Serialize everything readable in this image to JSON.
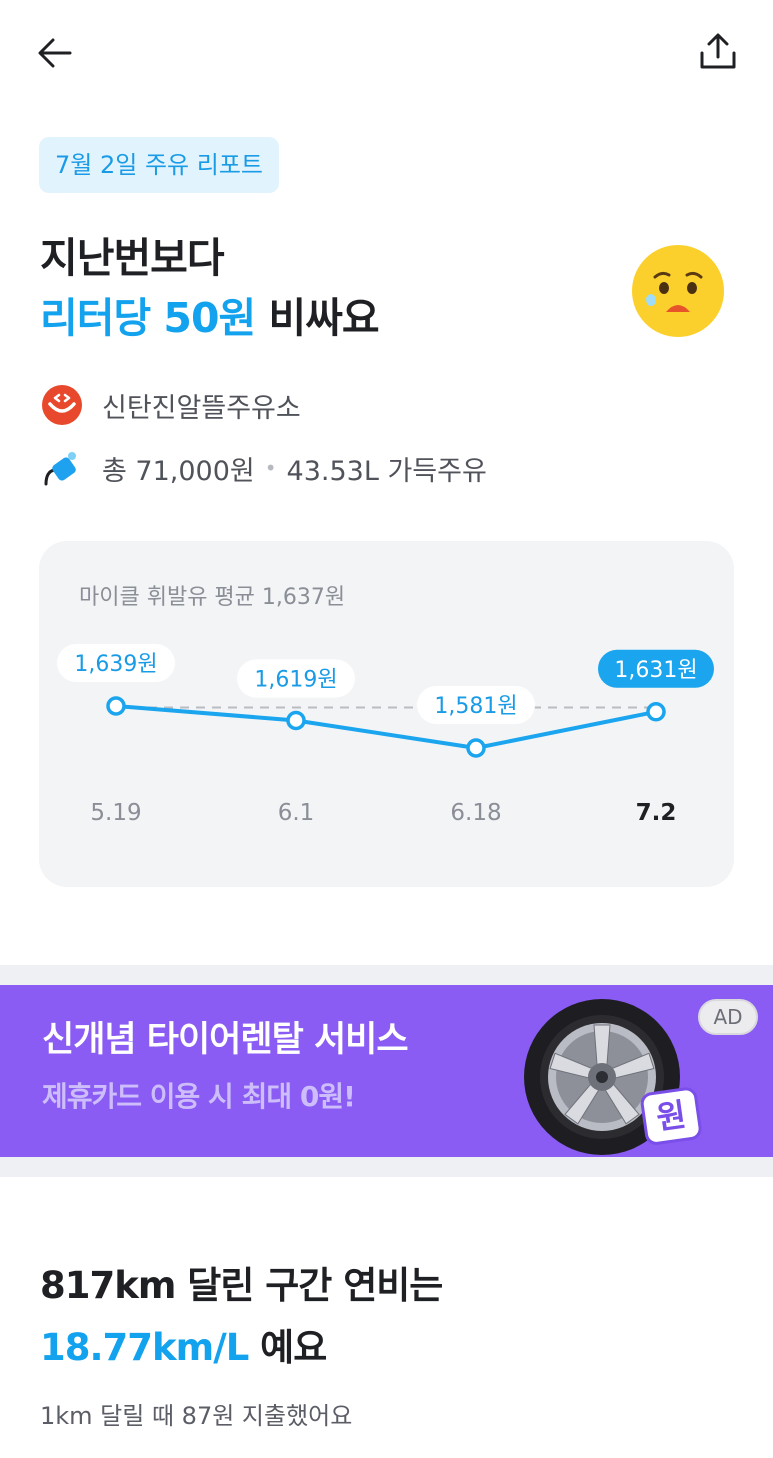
{
  "report_chip": "7월 2일 주유 리포트",
  "headline": {
    "line1": "지난번보다",
    "accent": "리터당 50원",
    "suffix": " 비싸요"
  },
  "station": {
    "name": "신탄진알뜰주유소",
    "icon": "smiley-logo-icon"
  },
  "fuel": {
    "total": "총 71,000원",
    "separator": "•",
    "detail": "43.53L 가득주유",
    "icon": "fuel-nozzle-icon"
  },
  "chart": {
    "avg_label": "마이클 휘발유 평균 1,637원"
  },
  "chart_data": {
    "type": "line",
    "categories": [
      "5.19",
      "6.1",
      "6.18",
      "7.2"
    ],
    "values": [
      1639,
      1619,
      1581,
      1631
    ],
    "value_labels": [
      "1,639원",
      "1,619원",
      "1,581원",
      "1,631원"
    ],
    "average": 1637,
    "highlight_index": 3,
    "colors": {
      "line": "#1aa5ee",
      "average": "#b9bcc2",
      "highlight": "#1aa5ee"
    }
  },
  "ad": {
    "title": "신개념 타이어렌탈 서비스",
    "subtitle": "제휴카드 이용 시 최대 0원!",
    "badge": "AD",
    "sticker": "원"
  },
  "efficiency": {
    "line1": "817km 달린 구간 연비는",
    "accent": "18.77km/L",
    "suffix": " 예요",
    "sub": "1km 달릴 때 87원 지출했어요"
  },
  "colors": {
    "accent": "#13a2ee",
    "ad_bg": "#8a5cf4",
    "card_bg": "#f3f4f6"
  }
}
